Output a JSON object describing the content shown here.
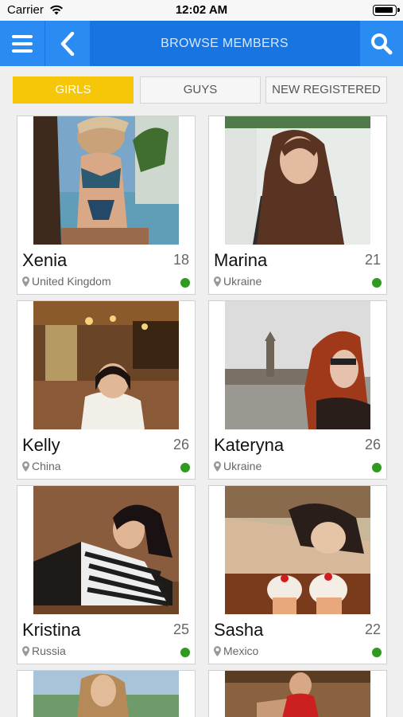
{
  "status_bar": {
    "carrier": "Carrier",
    "time": "12:02 AM"
  },
  "nav": {
    "title": "BROWSE MEMBERS",
    "menu_icon": "menu-icon",
    "back_icon": "back-icon",
    "search_icon": "search-icon"
  },
  "tabs": [
    {
      "label": "GIRLS",
      "active": true
    },
    {
      "label": "GUYS",
      "active": false
    },
    {
      "label": "NEW REGISTERED",
      "active": false
    }
  ],
  "members": [
    {
      "name": "Xenia",
      "age": "18",
      "location": "United Kingdom",
      "online": true
    },
    {
      "name": "Marina",
      "age": "21",
      "location": "Ukraine",
      "online": true
    },
    {
      "name": "Kelly",
      "age": "26",
      "location": "China",
      "online": true
    },
    {
      "name": "Kateryna",
      "age": "26",
      "location": "Ukraine",
      "online": true
    },
    {
      "name": "Kristina",
      "age": "25",
      "location": "Russia",
      "online": true
    },
    {
      "name": "Sasha",
      "age": "22",
      "location": "Mexico",
      "online": true
    }
  ],
  "colors": {
    "nav": "#1874e0",
    "nav_button": "#2a8cf2",
    "active_tab": "#f6c609",
    "online": "#2e9a1e"
  }
}
